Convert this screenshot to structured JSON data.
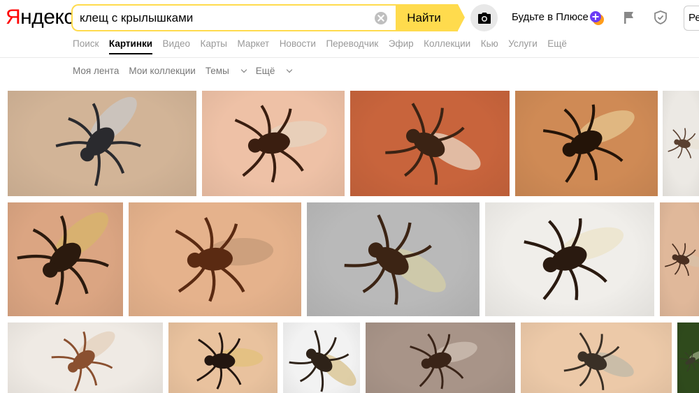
{
  "header": {
    "logo": "Яндекс",
    "search_value": "клещ с крылышками",
    "search_button": "Найти",
    "plus_label": "Будьте в Плюсе",
    "login_partial": "Ре"
  },
  "services": [
    {
      "label": "Поиск",
      "active": false
    },
    {
      "label": "Картинки",
      "active": true
    },
    {
      "label": "Видео",
      "active": false
    },
    {
      "label": "Карты",
      "active": false
    },
    {
      "label": "Маркет",
      "active": false
    },
    {
      "label": "Новости",
      "active": false
    },
    {
      "label": "Переводчик",
      "active": false
    },
    {
      "label": "Эфир",
      "active": false
    },
    {
      "label": "Коллекции",
      "active": false
    },
    {
      "label": "Кью",
      "active": false
    },
    {
      "label": "Услуги",
      "active": false
    },
    {
      "label": "Ещё",
      "active": false
    }
  ],
  "subnav": {
    "feed": "Моя лента",
    "collections": "Мои коллекции",
    "topics": "Темы",
    "more": "Ещё"
  },
  "colors": {
    "accent": "#ffdb4d",
    "logo_red": "#ff0000",
    "plus_purple": "#6b3cf5",
    "plus_orange": "#ff9c1a"
  },
  "results": [
    {
      "bg": "#d2b497",
      "fly": "#2a2a2e",
      "wing": "#c8c8c8"
    },
    {
      "bg": "#eec1a6",
      "fly": "#3a1e10",
      "wing": "#e6d3bf"
    },
    {
      "bg": "#c8643c",
      "fly": "#3b2314",
      "wing": "#e9d8c6"
    },
    {
      "bg": "#cf8a55",
      "fly": "#241408",
      "wing": "#e5c590"
    },
    {
      "bg": "#ece9e4",
      "fly": "#5a4030",
      "wing": "#e8e0d4"
    },
    {
      "bg": "#dba582",
      "fly": "#2b1a0e",
      "wing": "#d7b56a"
    },
    {
      "bg": "#e5b28c",
      "fly": "#5a2a12",
      "wing": "#c49a78"
    },
    {
      "bg": "#b9b9b9",
      "fly": "#3c2414",
      "wing": "#d6cfa6"
    },
    {
      "bg": "#f0eeea",
      "fly": "#2a1a10",
      "wing": "#ece3c8"
    },
    {
      "bg": "#e0b89a",
      "fly": "#4a2f20",
      "wing": "#d8c2a8"
    },
    {
      "bg": "#efeae4",
      "fly": "#8a5030",
      "wing": "#e4d0bc"
    },
    {
      "bg": "#e9c29e",
      "fly": "#231610",
      "wing": "#e2c07a"
    },
    {
      "bg": "#f2f2f2",
      "fly": "#2e2218",
      "wing": "#d8c28c"
    },
    {
      "bg": "#a89488",
      "fly": "#3a2418",
      "wing": "#cfc0b4"
    },
    {
      "bg": "#ecc9a8",
      "fly": "#3a3026",
      "wing": "#bfb8a8"
    },
    {
      "bg": "#2f4a1c",
      "fly": "#3a3a2a",
      "wing": "#9aa880"
    }
  ]
}
